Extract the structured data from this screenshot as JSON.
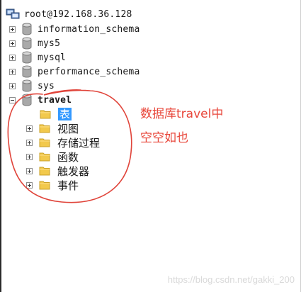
{
  "connection": {
    "label": "root@192.168.36.128",
    "icon": "server-connection-icon"
  },
  "databases": [
    {
      "name": "information_schema",
      "expanded": false,
      "icon": "database-icon"
    },
    {
      "name": "mys5",
      "expanded": false,
      "icon": "database-icon"
    },
    {
      "name": "mysql",
      "expanded": false,
      "icon": "database-icon"
    },
    {
      "name": "performance_schema",
      "expanded": false,
      "icon": "database-icon"
    },
    {
      "name": "sys",
      "expanded": false,
      "icon": "database-icon"
    },
    {
      "name": "travel",
      "expanded": true,
      "icon": "database-icon"
    }
  ],
  "travel_children": [
    {
      "label": "表",
      "selected": true,
      "icon": "folder-icon"
    },
    {
      "label": "视图",
      "selected": false,
      "icon": "folder-icon"
    },
    {
      "label": "存储过程",
      "selected": false,
      "icon": "folder-icon"
    },
    {
      "label": "函数",
      "selected": false,
      "icon": "folder-icon"
    },
    {
      "label": "触发器",
      "selected": false,
      "icon": "folder-icon"
    },
    {
      "label": "事件",
      "selected": false,
      "icon": "folder-icon"
    }
  ],
  "annotation": {
    "line1": "数据库travel中",
    "line2": "空空如也",
    "color": "#e8463a"
  },
  "watermark": "https://blog.csdn.net/gakki_200",
  "colors": {
    "selection": "#3399ff",
    "folder": "#f2c94c",
    "database": "#9a9a9a"
  }
}
